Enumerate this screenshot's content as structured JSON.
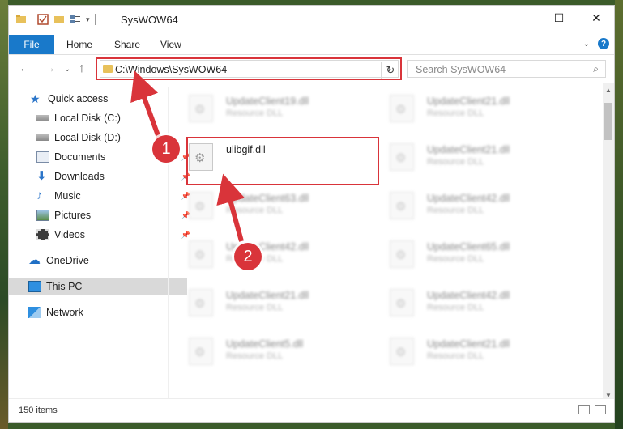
{
  "window": {
    "title": "SysWOW64",
    "controls": {
      "minimize": "—",
      "maximize": "☐",
      "close": "✕"
    }
  },
  "ribbon": {
    "tabs": [
      "File",
      "Home",
      "Share",
      "View"
    ]
  },
  "navigation": {
    "address": "C:\\Windows\\SysWOW64",
    "search_placeholder": "Search SysWOW64"
  },
  "sidebar": {
    "items": [
      {
        "label": "Quick access",
        "icon": "star-icon"
      },
      {
        "label": "Local Disk (C:)",
        "icon": "drive-icon"
      },
      {
        "label": "Local Disk (D:)",
        "icon": "drive-icon"
      },
      {
        "label": "Documents",
        "icon": "documents-icon",
        "pinned": true
      },
      {
        "label": "Downloads",
        "icon": "download-icon",
        "pinned": true
      },
      {
        "label": "Music",
        "icon": "music-icon",
        "pinned": true
      },
      {
        "label": "Pictures",
        "icon": "pictures-icon",
        "pinned": true
      },
      {
        "label": "Videos",
        "icon": "videos-icon",
        "pinned": true
      },
      {
        "label": "OneDrive",
        "icon": "cloud-icon"
      },
      {
        "label": "This PC",
        "icon": "computer-icon",
        "selected": true
      },
      {
        "label": "Network",
        "icon": "network-icon"
      }
    ]
  },
  "files": {
    "highlighted": {
      "name": "ulibgif.dll"
    },
    "items": [
      {
        "name": "UpdateClient19.dll",
        "type": "Resource DLL"
      },
      {
        "name": "UpdateClient21.dll",
        "type": "Resource DLL"
      },
      {
        "name": "UpdateClient21.dll",
        "type": "Resource DLL"
      },
      {
        "name": "UpdateClient63.dll",
        "type": "Resource DLL"
      },
      {
        "name": "UpdateClient42.dll",
        "type": "Resource DLL"
      },
      {
        "name": "UpdateClient42.dll",
        "type": "Resource DLL"
      },
      {
        "name": "UpdateClient65.dll",
        "type": "Resource DLL"
      },
      {
        "name": "UpdateClient21.dll",
        "type": "Resource DLL"
      },
      {
        "name": "UpdateClient42.dll",
        "type": "Resource DLL"
      },
      {
        "name": "UpdateClient5.dll",
        "type": "Resource DLL"
      },
      {
        "name": "UpdateClient21.dll",
        "type": "Resource DLL"
      }
    ]
  },
  "status": {
    "item_count": "150 items"
  },
  "callouts": {
    "one": "1",
    "two": "2"
  },
  "colors": {
    "accent": "#1979ca",
    "callout": "#d9343a"
  }
}
